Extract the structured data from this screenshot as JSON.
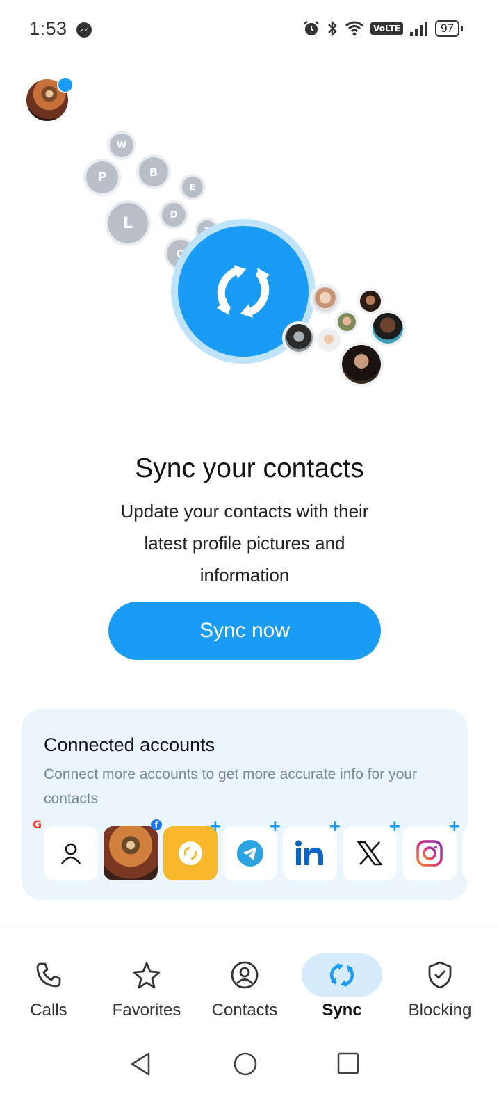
{
  "status_bar": {
    "time": "1:53",
    "volte": "VoLTE",
    "battery": "97",
    "icons": [
      "messenger-icon",
      "alarm-icon",
      "bluetooth-icon",
      "wifi-icon",
      "signal-icon",
      "battery-icon"
    ]
  },
  "hero": {
    "letter_bubbles": [
      "W",
      "P",
      "B",
      "E",
      "L",
      "D",
      "T",
      "O"
    ],
    "icon": "sync-icon"
  },
  "main": {
    "headline": "Sync your contacts",
    "subtitle": "Update your contacts with their latest profile pictures and information",
    "sync_button": "Sync now"
  },
  "connected_accounts": {
    "title": "Connected accounts",
    "description": "Connect more accounts to get more accurate info for your contacts",
    "accounts": [
      {
        "name": "contacts",
        "icon": "person-icon",
        "connected": true
      },
      {
        "name": "facebook",
        "icon": "profile-photo",
        "connected": true
      },
      {
        "name": "yellow-app",
        "icon": "circle-arrows-icon",
        "connected": false
      },
      {
        "name": "telegram",
        "icon": "telegram-icon",
        "connected": false
      },
      {
        "name": "linkedin",
        "icon": "linkedin-icon",
        "connected": false
      },
      {
        "name": "x",
        "icon": "x-icon",
        "connected": false
      },
      {
        "name": "instagram",
        "icon": "instagram-icon",
        "connected": false
      }
    ],
    "plus": "+",
    "badge_g": "G",
    "badge_f": "f"
  },
  "bottom_nav": {
    "items": [
      {
        "label": "Calls",
        "icon": "phone-icon"
      },
      {
        "label": "Favorites",
        "icon": "star-icon"
      },
      {
        "label": "Contacts",
        "icon": "person-circle-icon"
      },
      {
        "label": "Sync",
        "icon": "sync-icon",
        "active": true
      },
      {
        "label": "Blocking",
        "icon": "shield-check-icon"
      }
    ]
  },
  "colors": {
    "accent": "#1a9cf5",
    "card_bg": "#eaf5fd",
    "active_pill": "#d6ecfd"
  }
}
